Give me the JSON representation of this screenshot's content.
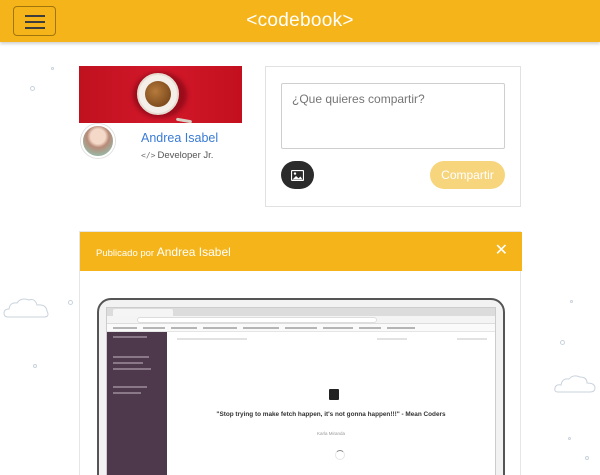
{
  "navbar": {
    "brand": "<codebook>",
    "menu_icon": "hamburger-menu-icon"
  },
  "profile": {
    "name": "Andrea Isabel",
    "role": "Developer Jr.",
    "role_icon": "code-icon"
  },
  "compose": {
    "placeholder": "¿Que quieres compartir?",
    "photo_icon": "image-icon",
    "share_label": "Compartir"
  },
  "post": {
    "published_by": "Publicado por",
    "author": "Andrea Isabel",
    "close_icon": "close-icon",
    "image": {
      "quote": "\"Stop trying to make fetch happen, it's not gonna happen!!!\" - Mean Coders",
      "quote_author": "Karla Miranda"
    }
  },
  "colors": {
    "accent": "#f5b51a",
    "link": "#3a7bd5",
    "share_disabled": "#f7d57c"
  }
}
